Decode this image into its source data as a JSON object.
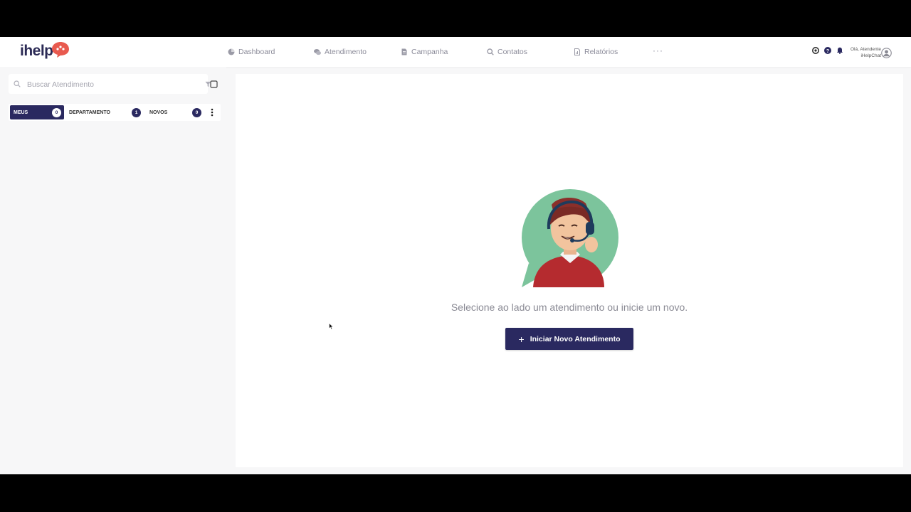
{
  "app": {
    "logo_text": "ihelp",
    "brand_color": "#2a2960",
    "accent_color": "#e85a4f"
  },
  "nav": {
    "items": [
      {
        "label": "Dashboard",
        "icon": "dashboard-icon"
      },
      {
        "label": "Atendimento",
        "icon": "chat-bubbles-icon"
      },
      {
        "label": "Campanha",
        "icon": "document-icon"
      },
      {
        "label": "Contatos",
        "icon": "search-icon"
      },
      {
        "label": "Relatórios",
        "icon": "report-icon"
      }
    ],
    "more_label": "···"
  },
  "header_icons": [
    "support-icon",
    "help-icon",
    "bell-icon"
  ],
  "user": {
    "greeting": "Olá, Atendente",
    "company": "iHelpChat"
  },
  "sidebar": {
    "search_placeholder": "Buscar Atendimento",
    "tabs": [
      {
        "label": "MEUS",
        "count": "0",
        "active": true
      },
      {
        "label": "DEPARTAMENTO",
        "count": "1",
        "active": false
      },
      {
        "label": "NOVOS",
        "count": "0",
        "active": false
      }
    ]
  },
  "main": {
    "empty_message": "Selecione ao lado um atendimento ou inicie um novo.",
    "new_button_label": "Iniciar Novo Atendimento"
  }
}
